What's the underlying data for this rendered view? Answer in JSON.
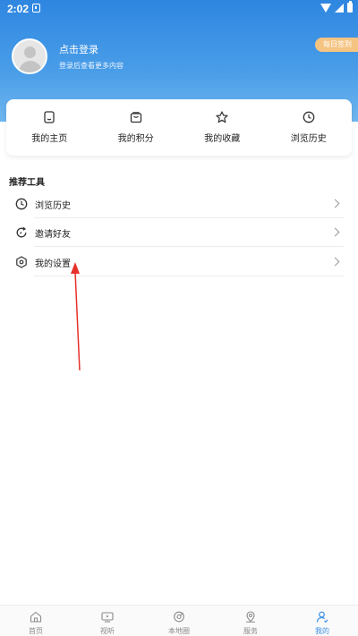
{
  "status_bar": {
    "time": "2:02"
  },
  "profile": {
    "login_title": "点击登录",
    "login_subtitle": "登录后查看更多内容",
    "checkin_label": "每日签到"
  },
  "quick_links": [
    {
      "label": "我的主页",
      "icon": "homepage-icon"
    },
    {
      "label": "我的积分",
      "icon": "points-bag-icon"
    },
    {
      "label": "我的收藏",
      "icon": "star-icon"
    },
    {
      "label": "浏览历史",
      "icon": "clock-icon"
    }
  ],
  "tools": {
    "section_title": "推荐工具",
    "items": [
      {
        "label": "浏览历史",
        "icon": "clock-icon"
      },
      {
        "label": "邀请好友",
        "icon": "refresh-icon"
      },
      {
        "label": "我的设置",
        "icon": "settings-hexagon-icon"
      }
    ]
  },
  "tab_bar": {
    "items": [
      {
        "label": "首页",
        "icon": "home-icon",
        "active": false
      },
      {
        "label": "视听",
        "icon": "tv-icon",
        "active": false
      },
      {
        "label": "本地圈",
        "icon": "local-circle-icon",
        "active": false
      },
      {
        "label": "服务",
        "icon": "service-location-icon",
        "active": false
      },
      {
        "label": "我的",
        "icon": "user-icon",
        "active": true
      }
    ]
  },
  "colors": {
    "header_gradient_top": "#2f86e0",
    "header_gradient_bottom": "#6fb6ef",
    "checkin_bg": "#f5c483",
    "tab_active": "#3b8fe6",
    "annotation_arrow": "#e8302a"
  }
}
